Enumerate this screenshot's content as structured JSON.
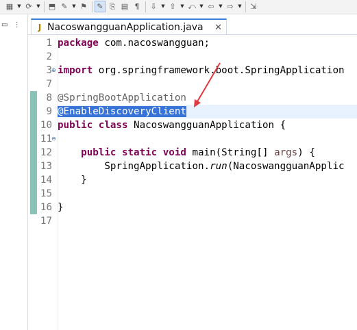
{
  "editor": {
    "tab_title": "NacoswangguanApplication.java",
    "tab_icon": "J",
    "tab_close": "✕",
    "lines": [
      {
        "n": "1",
        "tokens": [
          {
            "t": "package",
            "c": "kw"
          },
          {
            "t": " com.nacoswangguan;",
            "c": ""
          }
        ]
      },
      {
        "n": "2",
        "tokens": []
      },
      {
        "n": "3",
        "tokens": [
          {
            "t": "import",
            "c": "kw"
          },
          {
            "t": " org.springframework.boot.SpringApplication",
            "c": ""
          }
        ]
      },
      {
        "n": "7",
        "tokens": []
      },
      {
        "n": "8",
        "tokens": [
          {
            "t": "@SpringBootApplication",
            "c": "ann"
          }
        ]
      },
      {
        "n": "9",
        "tokens": [
          {
            "t": "@EnableDiscoveryClient",
            "c": "sel"
          }
        ]
      },
      {
        "n": "10",
        "tokens": [
          {
            "t": "public",
            "c": "kw"
          },
          {
            "t": " ",
            "c": ""
          },
          {
            "t": "class",
            "c": "kw"
          },
          {
            "t": " NacoswangguanApplication {",
            "c": ""
          }
        ]
      },
      {
        "n": "11",
        "tokens": []
      },
      {
        "n": "12",
        "tokens": [
          {
            "t": "    ",
            "c": ""
          },
          {
            "t": "public",
            "c": "kw"
          },
          {
            "t": " ",
            "c": ""
          },
          {
            "t": "static",
            "c": "kw"
          },
          {
            "t": " ",
            "c": ""
          },
          {
            "t": "void",
            "c": "kw"
          },
          {
            "t": " main(String[] ",
            "c": ""
          },
          {
            "t": "args",
            "c": "param"
          },
          {
            "t": ") {",
            "c": ""
          }
        ]
      },
      {
        "n": "13",
        "tokens": [
          {
            "t": "        SpringApplication.",
            "c": ""
          },
          {
            "t": "run",
            "c": "it"
          },
          {
            "t": "(NacoswangguanApplic",
            "c": ""
          }
        ]
      },
      {
        "n": "14",
        "tokens": [
          {
            "t": "    }",
            "c": ""
          }
        ]
      },
      {
        "n": "15",
        "tokens": []
      },
      {
        "n": "16",
        "tokens": [
          {
            "t": "}",
            "c": ""
          }
        ]
      },
      {
        "n": "17",
        "tokens": []
      }
    ]
  },
  "toolbar": {
    "icons": [
      "package-icon",
      "run-icon",
      "open-icon",
      "tools-icon",
      "filter-icon",
      "highlight-icon",
      "doc-icon",
      "page-icon",
      "paragraph-icon",
      "next-annotation-icon",
      "prev-annotation-icon",
      "back-edit-icon",
      "back-icon",
      "forward-icon",
      "pin-icon"
    ],
    "glyphs": [
      "▦",
      "⟳",
      "⬒",
      "✎",
      "⚑",
      "✎",
      "⎘",
      "▤",
      "¶",
      "⇩",
      "⇧",
      "⤺",
      "⇦",
      "⇨",
      "⇲"
    ],
    "dropdown": "▼"
  },
  "left_strip": {
    "items": [
      "▭",
      "⋮"
    ]
  },
  "colors": {
    "keyword": "#7f0055",
    "annotation": "#646464",
    "selection": "#3874d8",
    "arrow": "#e0383e"
  }
}
